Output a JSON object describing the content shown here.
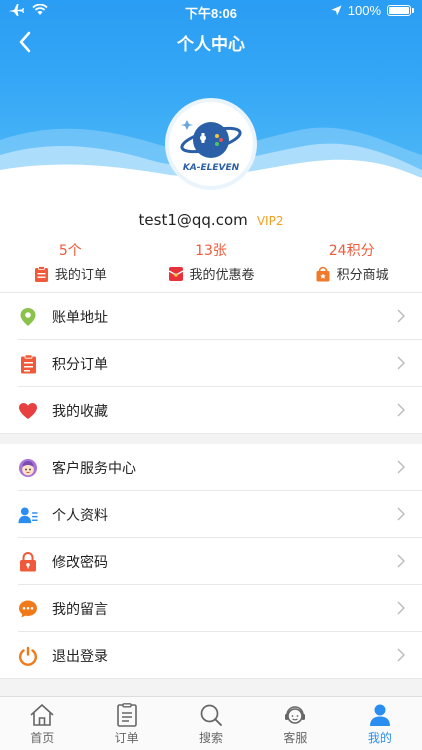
{
  "status_bar": {
    "time": "下午8:06",
    "battery": "100%"
  },
  "nav": {
    "title": "个人中心"
  },
  "profile": {
    "logo_text": "KA-ELEVEN",
    "email": "test1@qq.com",
    "vip": "VIP2"
  },
  "stats": [
    {
      "count": "5个",
      "label": "我的订单",
      "icon": "order-icon"
    },
    {
      "count": "13张",
      "label": "我的优惠卷",
      "icon": "coupon-icon"
    },
    {
      "count": "24积分",
      "label": "积分商城",
      "icon": "points-mall-icon"
    }
  ],
  "menu_group_1": [
    {
      "label": "账单地址",
      "icon": "location-pin-icon"
    },
    {
      "label": "积分订单",
      "icon": "clipboard-icon"
    },
    {
      "label": "我的收藏",
      "icon": "heart-icon"
    }
  ],
  "menu_group_2": [
    {
      "label": "客户服务中心",
      "icon": "customer-service-icon"
    },
    {
      "label": "个人资料",
      "icon": "profile-icon"
    },
    {
      "label": "修改密码",
      "icon": "lock-icon"
    },
    {
      "label": "我的留言",
      "icon": "message-icon"
    },
    {
      "label": "退出登录",
      "icon": "power-icon"
    }
  ],
  "tabbar": [
    {
      "label": "首页",
      "icon": "home-icon"
    },
    {
      "label": "订单",
      "icon": "order-list-icon"
    },
    {
      "label": "搜索",
      "icon": "search-icon"
    },
    {
      "label": "客服",
      "icon": "support-agent-icon"
    },
    {
      "label": "我的",
      "icon": "user-icon",
      "active": true
    }
  ],
  "colors": {
    "accent": "#2a8ef0",
    "header": "#36a8f6",
    "stat_number": "#f05a3a",
    "vip": "#f2a020"
  }
}
